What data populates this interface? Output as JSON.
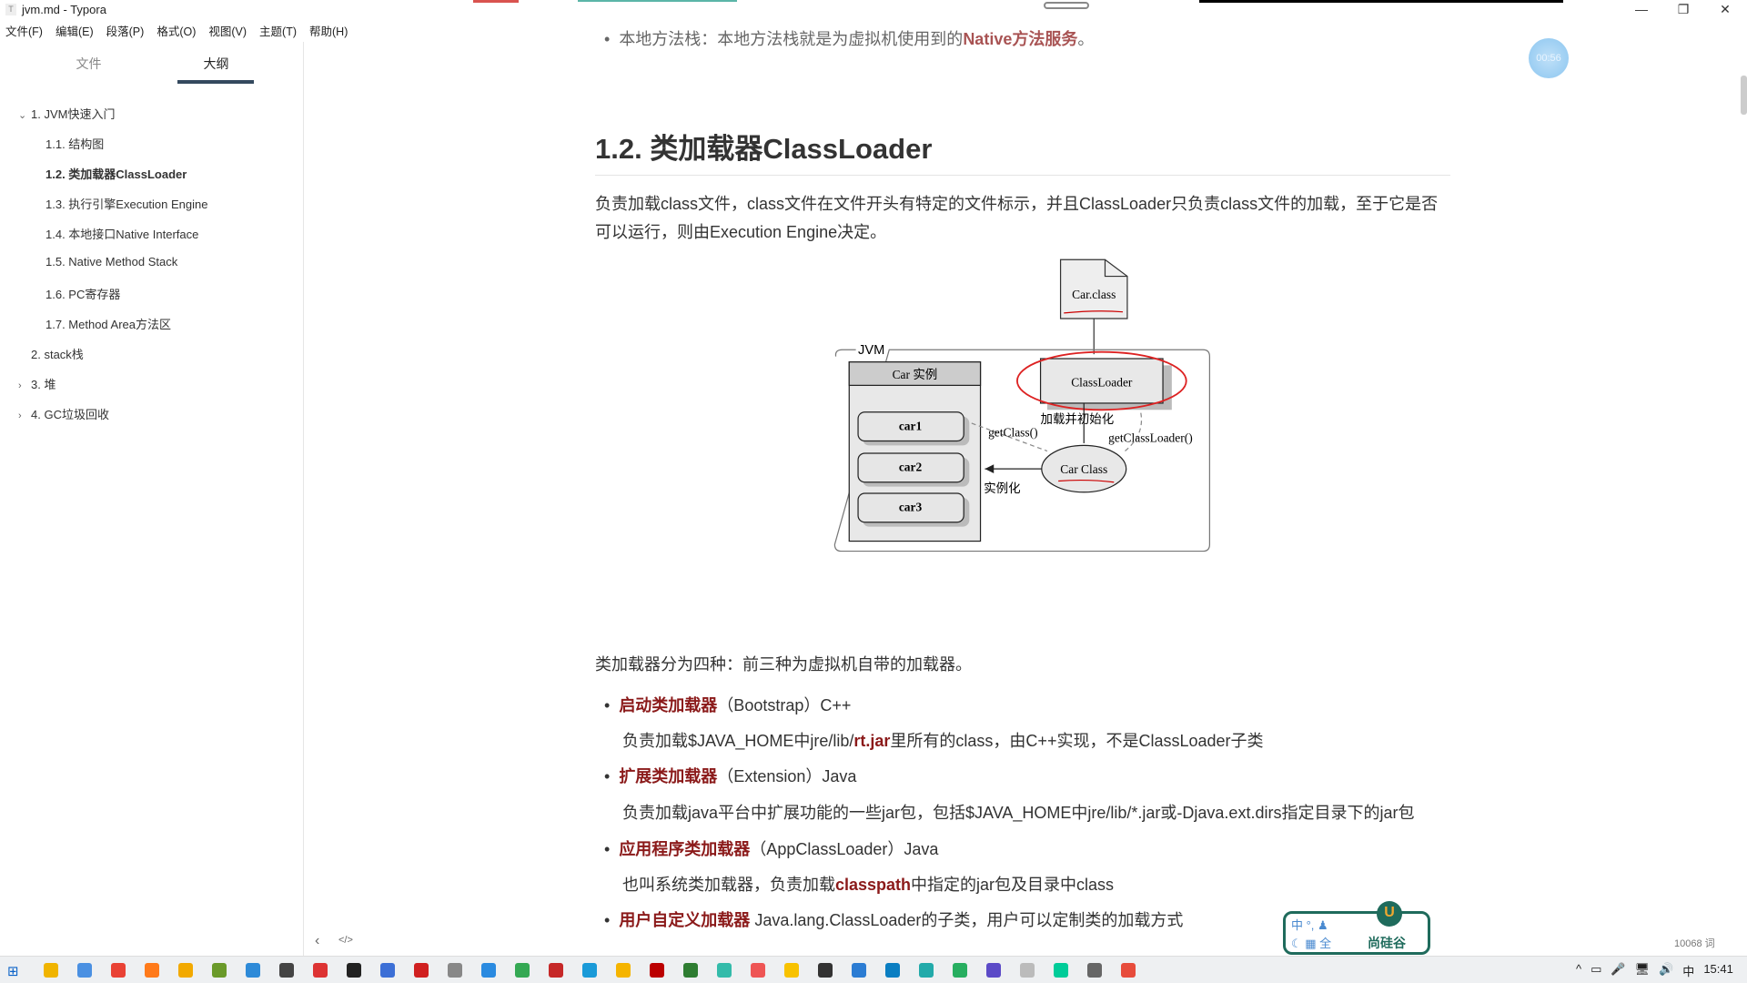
{
  "window": {
    "title": "jvm.md - Typora",
    "minimize": "—",
    "restore": "❐",
    "close": "✕"
  },
  "menu": [
    "文件(F)",
    "编辑(E)",
    "段落(P)",
    "格式(O)",
    "视图(V)",
    "主题(T)",
    "帮助(H)"
  ],
  "sidebar": {
    "tabs": [
      "文件",
      "大纲"
    ],
    "active_tab": "大纲",
    "outline": [
      {
        "label": "1. JVM快速入门",
        "level": 1,
        "chevron": "⌄"
      },
      {
        "label": "1.1. 结构图",
        "level": 2
      },
      {
        "label": "1.2. 类加载器ClassLoader",
        "level": 2,
        "active": true
      },
      {
        "label": "1.3. 执行引擎Execution Engine",
        "level": 2
      },
      {
        "label": "1.4. 本地接口Native Interface",
        "level": 2
      },
      {
        "label": "1.5. Native Method Stack",
        "level": 2
      },
      {
        "label": "1.6. PC寄存器",
        "level": 2
      },
      {
        "label": "1.7. Method Area方法区",
        "level": 2
      },
      {
        "label": "2. stack栈",
        "level": 1
      },
      {
        "label": "3. 堆",
        "level": 1,
        "chevron": "›"
      },
      {
        "label": "4. GC垃圾回收",
        "level": 1,
        "chevron": "›"
      }
    ]
  },
  "content": {
    "top_bullet": {
      "text": "本地方法栈：本地方法栈就是为虚拟机使用到的",
      "bold": "Native方法服务",
      "end": "。"
    },
    "heading": "1.2. 类加载器ClassLoader",
    "intro": "负责加载class文件，class文件在文件开头有特定的文件标示，并且ClassLoader只负责class文件的加载，至于它是否可以运行，则由Execution Engine决定。",
    "diagram": {
      "file": "Car.class",
      "jvm": "JVM",
      "instances_title": "Car 实例",
      "cars": [
        "car1",
        "car2",
        "car3"
      ],
      "classloader": "ClassLoader",
      "load_init": "加载并初始化",
      "getclass": "getClass()",
      "getclassloader": "getClassLoader()",
      "car_class": "Car Class",
      "instantiate": "实例化"
    },
    "types_intro": "类加载器分为四种：前三种为虚拟机自带的加载器。",
    "loaders": [
      {
        "name": "启动类加载器",
        "detail": "（Bootstrap）C++",
        "desc_parts": [
          "负责加载$JAVA_HOME中jre/lib/",
          "rt.jar",
          "里所有的class，由C++实现，不是ClassLoader子类"
        ]
      },
      {
        "name": "扩展类加载器",
        "detail": "（Extension）Java",
        "desc_parts": [
          "负责加载java平台中扩展功能的一些jar包，包括$JAVA_HOME中jre/lib/*.jar或-Djava.ext.dirs指定目录下的jar包",
          "",
          ""
        ]
      },
      {
        "name": "应用程序类加载器",
        "detail": "（AppClassLoader）Java",
        "desc_parts": [
          "也叫系统类加载器，负责加载",
          "classpath",
          "中指定的jar包及目录中class"
        ]
      },
      {
        "name": "用户自定义加载器",
        "detail": " Java.lang.ClassLoader的子类，用户可以定制类的加载方式"
      }
    ]
  },
  "overlay": {
    "timer": "00:56",
    "ime": {
      "row1": "中 °, ♟",
      "row2": "☾ ▦ 全",
      "brand": "尚硅谷",
      "logo": "U"
    }
  },
  "statusbar": {
    "back": "‹",
    "source": "</>",
    "word_count": "10068 词"
  },
  "taskbar": {
    "tray": [
      "^",
      "▭",
      "🎤",
      "🖥",
      "🔊",
      "中"
    ],
    "time": "15:41"
  },
  "colors": {
    "accent": "#8b1a1a",
    "outline_underline": "#34495e",
    "ime_border": "#1f6b5c"
  }
}
